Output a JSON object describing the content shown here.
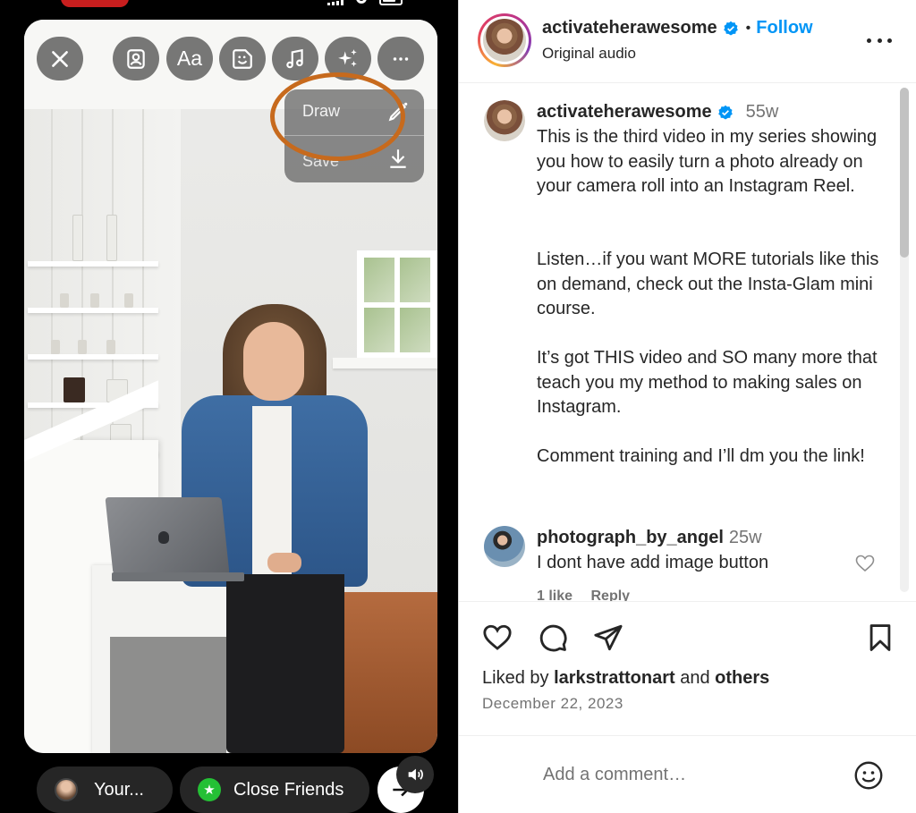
{
  "story_editor": {
    "toolbar": {
      "close": "close-icon",
      "tools": [
        {
          "name": "mention",
          "icon": "person-card-icon"
        },
        {
          "name": "text",
          "label": "Aa"
        },
        {
          "name": "sticker",
          "icon": "sticker-icon"
        },
        {
          "name": "music",
          "icon": "music-note-icon"
        },
        {
          "name": "effects",
          "icon": "sparkles-icon"
        },
        {
          "name": "more",
          "icon": "more-icon"
        }
      ]
    },
    "menu": {
      "items": [
        {
          "label": "Draw",
          "icon": "draw-icon"
        },
        {
          "label": "Save",
          "icon": "download-icon"
        }
      ],
      "annotation_color": "#c76a1d"
    },
    "share": {
      "your_story": "Your...",
      "close_friends": "Close Friends"
    }
  },
  "post": {
    "author": {
      "username": "activateherawesome",
      "verified": true,
      "follow_label": "Follow",
      "audio": "Original audio"
    },
    "caption": {
      "username": "activateherawesome",
      "time": "55w",
      "paragraphs": [
        "This is the third video in my series showing you how to easily turn a photo already on your camera roll into an Instagram Reel.",
        "Listen…if you want MORE tutorials like this on demand, check out the Insta-Glam mini course.",
        "It’s got THIS video and SO many more that teach you my method to making sales on Instagram.",
        "Comment training and I’ll dm you the link!"
      ]
    },
    "comments": [
      {
        "username": "photograph_by_angel",
        "time": "25w",
        "text": "I dont have add image button",
        "likes": "1 like",
        "reply": "Reply"
      }
    ],
    "liked_by": {
      "prefix": "Liked by",
      "user": "larkstrattonart",
      "conjunction": "and",
      "others": "others"
    },
    "date": "December 22, 2023",
    "comment_placeholder": "Add a comment…"
  },
  "colors": {
    "accent": "#0095f6",
    "text": "#262626",
    "secondary": "#737373"
  }
}
